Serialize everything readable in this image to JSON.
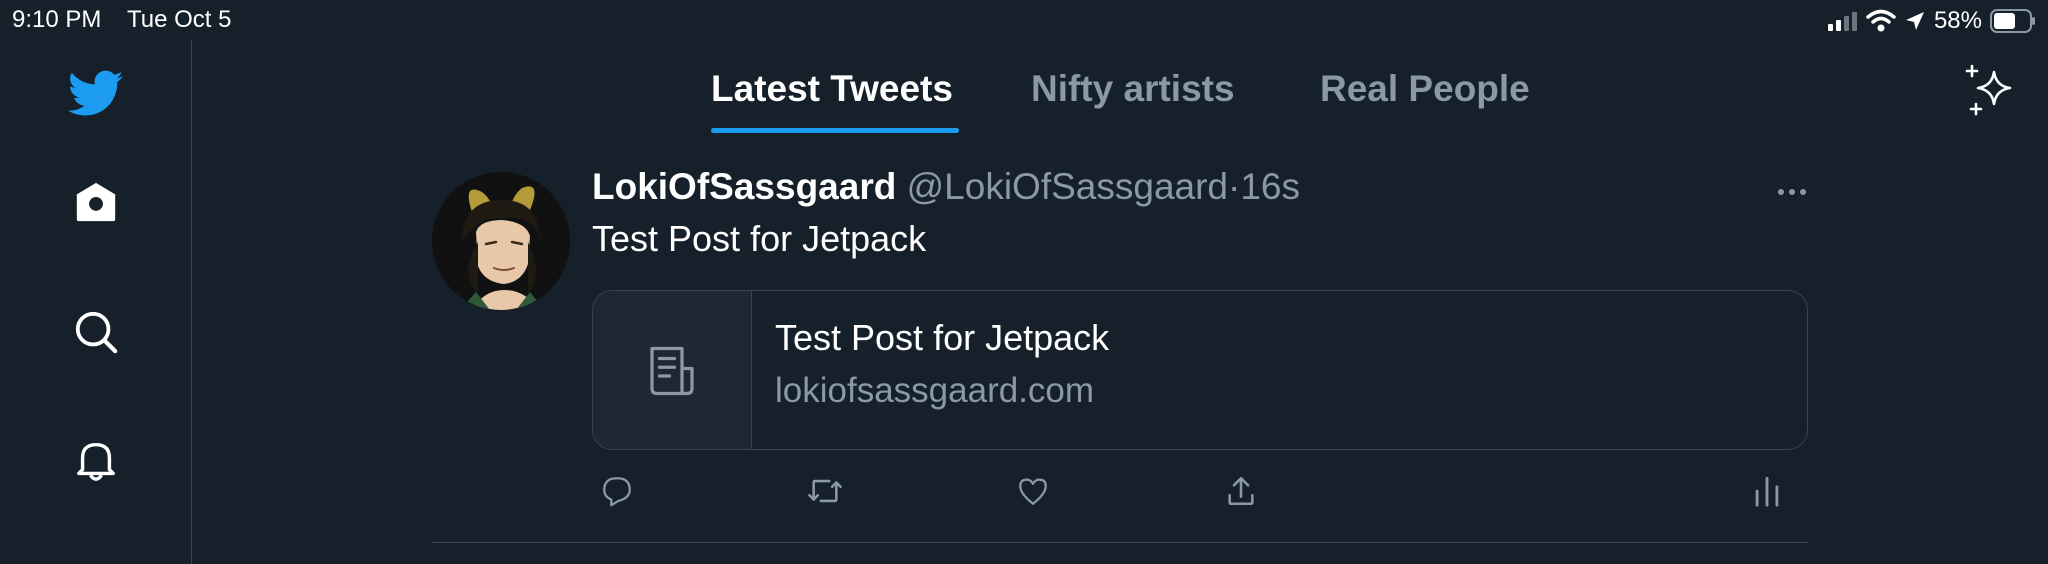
{
  "status_bar": {
    "time": "9:10 PM",
    "date": "Tue Oct 5",
    "battery": "58%",
    "icons": [
      "signal-icon",
      "wifi-icon",
      "location-arrow-icon",
      "battery-icon"
    ]
  },
  "sidebar": {
    "items": [
      {
        "name": "twitter-logo-icon"
      },
      {
        "name": "home-icon"
      },
      {
        "name": "search-icon"
      },
      {
        "name": "notifications-bell-icon"
      }
    ]
  },
  "tabs": [
    {
      "label": "Latest Tweets",
      "active": true
    },
    {
      "label": "Nifty artists",
      "active": false
    },
    {
      "label": "Real People",
      "active": false
    }
  ],
  "tweet": {
    "display_name": "LokiOfSassgaard",
    "handle": "@LokiOfSassgaard",
    "separator": "·",
    "time": "16s",
    "text": "Test Post for Jetpack",
    "card": {
      "title": "Test Post for Jetpack",
      "domain": "lokiofsassgaard.com"
    },
    "actions": [
      "reply-icon",
      "retweet-icon",
      "like-icon",
      "share-icon",
      "analytics-icon"
    ]
  },
  "colors": {
    "background": "#15202b",
    "accent": "#1d9bf0",
    "secondary_text": "#8b98a5",
    "border": "#38444d"
  }
}
